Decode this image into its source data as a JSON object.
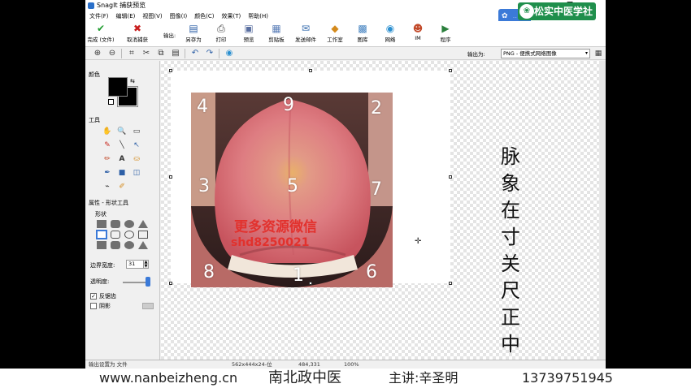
{
  "window": {
    "title": "SnagIt 捕获预览",
    "controls": {
      "minimize": "—",
      "maximize": "❐",
      "close": "✕"
    }
  },
  "menu": [
    "文件(F)",
    "编辑(E)",
    "视图(V)",
    "图像(I)",
    "颜色(C)",
    "效果(T)",
    "帮助(H)"
  ],
  "logo": {
    "text": "松实中医学社",
    "seal": "❀",
    "badge_text": "..."
  },
  "ribbon": {
    "output_label": "输出:",
    "buttons": [
      {
        "label": "完成 (文件)",
        "icon": "✔",
        "color": "#1f9c2f"
      },
      {
        "label": "取消捕获",
        "icon": "✖",
        "color": "#c81e1e"
      },
      {
        "label": "另存为",
        "icon": "▤",
        "color": "#2d5fa6"
      },
      {
        "label": "打印",
        "icon": "⎙",
        "color": "#444444"
      },
      {
        "label": "预览",
        "icon": "▣",
        "color": "#5a6fa0"
      },
      {
        "label": "剪贴板",
        "icon": "▦",
        "color": "#5c7fb8"
      },
      {
        "label": "发送邮件",
        "icon": "✉",
        "color": "#3a6fb0"
      },
      {
        "label": "工作室",
        "icon": "◆",
        "color": "#d48a1c"
      },
      {
        "label": "图库",
        "icon": "▩",
        "color": "#3f7fbf"
      },
      {
        "label": "网络",
        "icon": "◉",
        "color": "#2a8fd0"
      },
      {
        "label": "IM",
        "icon": "☻",
        "color": "#c24a2a"
      },
      {
        "label": "程序",
        "icon": "▶",
        "color": "#2a7f3c"
      }
    ]
  },
  "toolbar2": {
    "output_format_label": "输出为:",
    "output_format_value": "PNG - 便携式网络图像",
    "dropdown_glyph": "▾",
    "tools": [
      "⊕",
      "⊖",
      "⌗",
      "✂",
      "⧉",
      "▤",
      "↶",
      "↷",
      "◉"
    ]
  },
  "left_panel": {
    "color_label": "颜色",
    "swap_glyph": "⇆",
    "tools_label": "工具",
    "tools": [
      "✋",
      "🔍",
      "▭",
      "✎",
      "╲",
      "↖",
      "✏",
      "A",
      "⛀",
      "✒",
      "■",
      "◫",
      "⌁",
      "✐"
    ],
    "properties_label": "属性 - 形状工具",
    "shape_label": "形状",
    "border_label": "边界宽度:",
    "border_value": "31",
    "spin_up": "▲",
    "spin_down": "▼",
    "opacity_label": "透明度:",
    "antialias_label": "反锯齿",
    "antialias_checked": true,
    "check_mark": "✓",
    "shadow_label": "阴影",
    "shadow_checked": false
  },
  "canvas": {
    "zone_numbers": [
      "4",
      "9",
      "2",
      "3",
      "5",
      "7",
      "8",
      "1",
      "6"
    ],
    "watermark_line1": "更多资源微信",
    "watermark_line2": "shd8250021",
    "vertical_text": [
      "脉",
      "象",
      "在",
      "寸",
      "关",
      "尺",
      "正",
      "中"
    ],
    "cursor_glyph": "✛"
  },
  "statusbar": {
    "left": "输出设置为 文件",
    "size": "562x444x24-位",
    "position": "484,331",
    "zoom": "100%"
  },
  "caption": {
    "website": "www.nanbeizheng.cn",
    "org": "南北政中医",
    "lecturer": "主讲:辛圣明",
    "phone": "13739751945"
  }
}
